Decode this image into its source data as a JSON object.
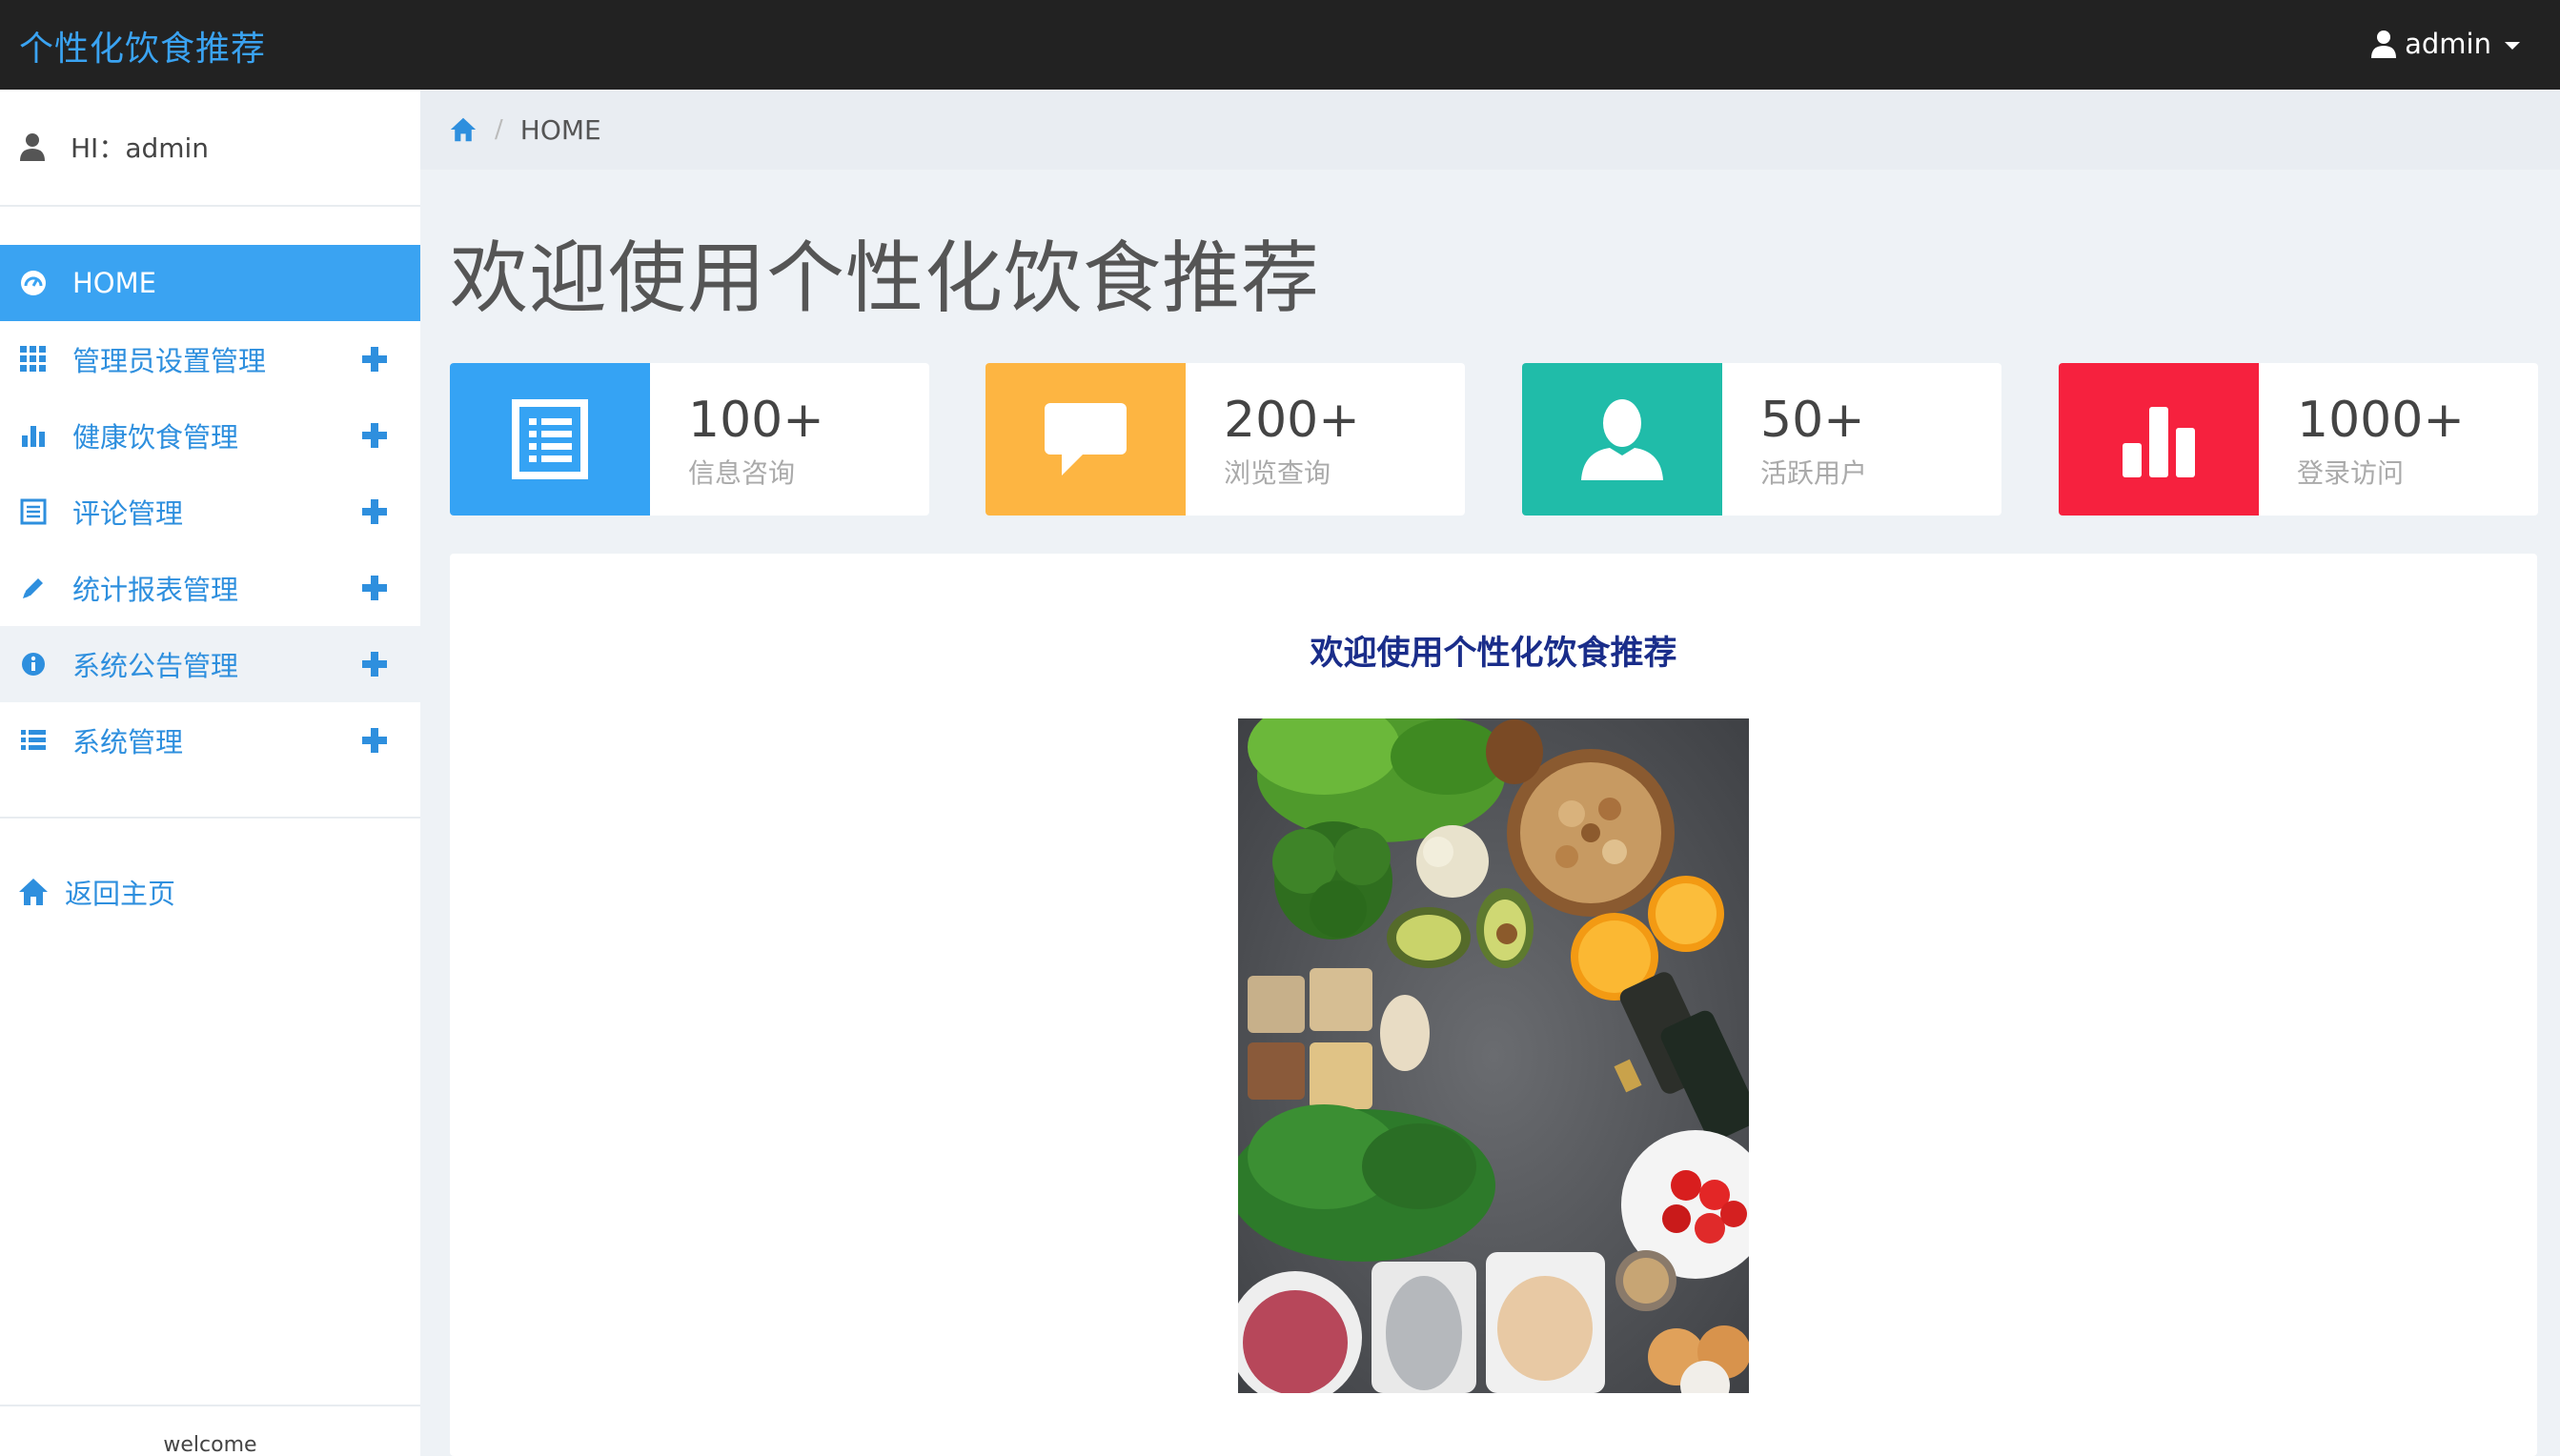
{
  "app": {
    "brand": "个性化饮食推荐"
  },
  "header": {
    "user": "admin"
  },
  "sidebar": {
    "greeting": "HI：admin",
    "items": [
      {
        "label": "HOME",
        "icon": "dashboard-icon",
        "active": true
      },
      {
        "label": "管理员设置管理",
        "icon": "grid-icon"
      },
      {
        "label": "健康饮食管理",
        "icon": "bar-chart-icon"
      },
      {
        "label": "评论管理",
        "icon": "list-alt-icon"
      },
      {
        "label": "统计报表管理",
        "icon": "pencil-icon"
      },
      {
        "label": "系统公告管理",
        "icon": "info-icon"
      },
      {
        "label": "系统管理",
        "icon": "list-icon"
      }
    ],
    "back_home": "返回主页",
    "footer": "welcome"
  },
  "breadcrumb": {
    "current": "HOME"
  },
  "main": {
    "title": "欢迎使用个性化饮食推荐",
    "stats": [
      {
        "value": "100+",
        "label": "信息咨询",
        "color": "#35a3f4",
        "icon": "list-alt-icon"
      },
      {
        "value": "200+",
        "label": "浏览查询",
        "color": "#fdb542",
        "icon": "comment-icon"
      },
      {
        "value": "50+",
        "label": "活跃用户",
        "color": "#20bca9",
        "icon": "user-icon"
      },
      {
        "value": "1000+",
        "label": "登录访问",
        "color": "#f6213e",
        "icon": "stats-icon"
      }
    ],
    "panel_title": "欢迎使用个性化饮食推荐"
  },
  "colors": {
    "accent": "#3aa3f2",
    "topbar": "#222222",
    "link": "#2e8fde"
  }
}
